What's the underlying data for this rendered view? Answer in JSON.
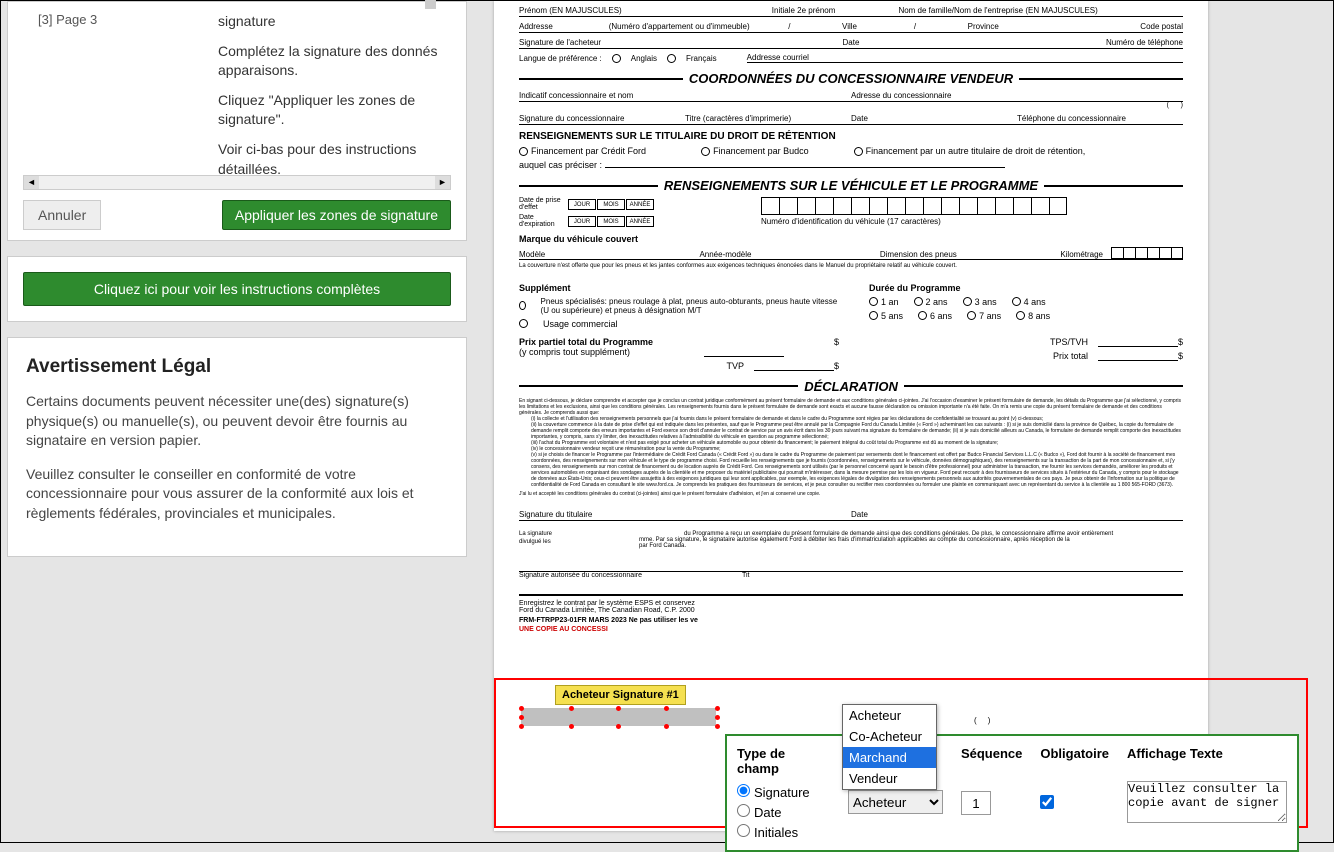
{
  "leftPanel": {
    "pageLabel": "[3] Page 3",
    "instr1": "signature",
    "instr2": "Complétez la signature des donnés apparaisons.",
    "instr3": "Cliquez \"Appliquer les zones de signature\".",
    "instr4": "Voir ci-bas pour des instructions détaillées.",
    "cancelBtn": "Annuler",
    "applyBtn": "Appliquer les zones de signature",
    "fullInstrBtn": "Cliquez ici pour voir les instructions complètes",
    "legalTitle": "Avertissement Légal",
    "legalP1": "Certains documents peuvent nécessiter une(des) signature(s) physique(s) ou manuelle(s), ou peuvent devoir être fournis au signataire en version papier.",
    "legalP2": "Veuillez consulter le conseiller en conformité de votre concessionnaire pour vous assurer de la conformité aux lois et règlements fédérales, provinciales et municipales."
  },
  "doc": {
    "prenom": "Prénom (EN MAJUSCULES)",
    "initiale": "Initiale 2e prénom",
    "nomFamille": "Nom de famille/Nom de l'entreprise (EN MAJUSCULES)",
    "addresse": "Addresse",
    "numApp": "(Numéro d'appartement ou d'immeuble)",
    "ville": "Ville",
    "province": "Province",
    "codePostal": "Code postal",
    "sigAcheteur": "Signature de l'acheteur",
    "date": "Date",
    "numTel": "Numéro de téléphone",
    "langPref": "Langue de préférence :",
    "anglais": "Anglais",
    "francais": "Français",
    "addrCourriel": "Addresse courriel",
    "coordTitle": "COORDONNÉES DU CONCESSIONNAIRE VENDEUR",
    "indicatif": "Indicatif concessionnaire et nom",
    "adrConc": "Adresse du concessionnaire",
    "sigConc": "Signature du concessionnaire",
    "titre": "Titre (caractères d'imprimerie)",
    "telConc": "Téléphone du concessionnaire",
    "rensTitulaire": "RENSEIGNEMENTS SUR LE TITULAIRE DU DROIT DE RÉTENTION",
    "finFord": "Financement par Crédit Ford",
    "finBudco": "Financement par Budco",
    "finAutre": "Financement par un autre titulaire de droit de rétention,",
    "auquel": "auquel cas préciser :",
    "rensVehicule": "RENSEIGNEMENTS SUR LE VÉHICULE ET LE PROGRAMME",
    "datePrise": "Date de prise d'effet",
    "dateExp": "Date d'expiration",
    "jour": "JOUR",
    "mois": "MOIS",
    "annee": "ANNÉE",
    "numIdent": "Numéro d'identification du véhicule (17 caractères)",
    "marque": "Marque du véhicule couvert",
    "modele": "Modèle",
    "anneeModele": "Année-modèle",
    "dimPneus": "Dimension des pneus",
    "kilometrage": "Kilométrage",
    "coverageNote": "La couverture n'est offerte que pour les pneus et les jantes conformes aux exigences techniques énoncées dans le Manuel du propriétaire relatif au véhicule couvert.",
    "supplement": "Supplément",
    "pneusSpec": "Pneus spécialisés: pneus roulage à plat, pneus auto-obturants, pneus haute vitesse (U ou supérieure) et pneus à désignation M/T",
    "usageComm": "Usage commercial",
    "dureeProgramme": "Durée du Programme",
    "an1": "1 an",
    "ans2": "2 ans",
    "ans3": "3 ans",
    "ans4": "4 ans",
    "ans5": "5 ans",
    "ans6": "6 ans",
    "ans7": "7 ans",
    "ans8": "8 ans",
    "prixPartiel": "Prix partiel total du Programme",
    "yCompris": "(y compris tout supplément)",
    "tvp": "TVP",
    "tps": "TPS/TVH",
    "prixTotal": "Prix total",
    "declaration": "DÉCLARATION",
    "decl1": "En signant ci-dessous, je déclare comprendre et accepter que je conclus un contrat juridique conformément au présent formulaire de demande et aux conditions générales ci-jointes. J'ai l'occasion d'examiner le présent formulaire de demande, les détails du Programme que j'ai sélectionné, y compris les limitations et les exclusions, ainsi que les conditions générales. Les renseignements fournis dans le présent formulaire de demande sont exacts et aucune fausse déclaration ou omission importante n'a été faite. On m'a remis une copie du présent formulaire de demande et des conditions générales. Je comprends aussi que:",
    "decla": "(i)   la collecte et l'utilisation des renseignements personnels que j'ai fournis dans le présent formulaire de demande et dans le cadre du Programme sont régies par les déclarations de confidentialité se trouvant au point (v) ci-dessous;",
    "declb": "(ii)  la couverture commence à la date de prise d'effet qui est indiquée dans les présentes, sauf que le Programme peut être annulé par la Compagnie Ford du Canada Limitée (« Ford ») acheminant les cas suivants : (i) si je suis domicilié dans la province de Québec, la copie du formulaire de demande remplit comporte des erreurs importantes et Ford exerce son droit d'annuler le contrat de service par un avis écrit dans les 30 jours suivant ma signature du formulaire de demande; (ii) si je suis domicilié ailleurs au Canada, le formulaire de demande remplit comporte des inexactitudes importantes, y compris, sans s'y limiter, des inexactitudes relatives à l'admissibilité du véhicule en question au programme sélectionné;",
    "declc": "(iii) l'achat du Programme est volontaire et n'est pas exigé pour acheter un véhicule automobile ou pour obtenir du financement; le paiement intégral du coût total du Programme est dû au moment de la signature;",
    "decld": "(iv)  le concessionnaire vendeur reçoit une rémunération pour la vente du Programme;",
    "decle": "(v)   si je choisis de financer le Programme par l'intermédiaire de Crédit Ford Canada (« Crédit Ford ») ou dans le cadre du Programme de paiement par versements dont le financement est offert par Budco Financial Services L.L.C (« Budco »), Ford doit fournir à la société de financement mes coordonnées, des renseignements sur mon véhicule et le type de programme choisi. Ford recueille les renseignements que je fournis (coordonnées, renseignements sur le véhicule, données démographiques), des renseignements sur la transaction de la part de mon concessionnaire et, si j'y consens, des renseignements sur mon contrat de financement ou de location auprès de Crédit Ford. Ces renseignements sont utilisés (par le personnel concerné ayant le besoin d'être professionnel) pour administrer la transaction, me fournir les services demandés, améliorer les produits et services automobiles en organisant des sondages auprès de la clientèle et me proposer du matériel publicitaire qui pourrait m'intéresser, dans la mesure permise par les lois en vigueur. Ford peut recourir à des fournisseurs de services situés à l'extérieur du Canada, y compris pour le stockage de données aux États-Unis; ceux-ci peuvent être assujettis à des exigences juridiques qui leur sont applicables, par exemple, les exigences légales de divulgation des renseignements personnels aux autorités gouvernementales de ces pays. Je peux obtenir de l'information sur la politique de confidentialité de Ford Canada en consultant le site www.ford.ca. Je comprends les pratiques des fournisseurs de services, et je peux consulter ou rectifier mes coordonnées ou formuler une plainte en communiquant avec un représentant du service à la clientèle au 1 800 565-FORD (3673).",
    "decl2": "J'ai lu et accepté les conditions générales du contrat (ci-jointes) ainsi que le présent formulaire d'adhésion, et j'en ai conservé une copie.",
    "sigTitulaire": "Signature du titulaire",
    "acheteurSig": "Acheteur Signature #1",
    "hiddenText1": "du Programme a reçu un exemplaire du présent formulaire de demande ainsi que des conditions générales. De plus, le concessionnaire affirme avoir entièrement",
    "hiddenText2": "mme. Par sa signature, le signataire autorise également Ford à débiter les frais d'immatriculation applicables au compte du concessionnaire, après réception de la",
    "hiddenText3": "par Ford Canada.",
    "sigAutorisee": "Signature autorisée du concessionnaire",
    "enregistrez": "Enregistrez le contrat par le système ESPS et conservez",
    "fordCanada": "Ford du Canada Limitée, The Canadian Road, C.P. 2000",
    "frmCode": "FRM-FTRPP23-01FR   MARS 2023   Ne pas utiliser les ve",
    "uneCopie": "UNE COPIE AU CONCESSI"
  },
  "popup": {
    "typeChamp": "Type de champ",
    "signature": "Signature",
    "dateOpt": "Date",
    "initiales": "Initiales",
    "sequence": "Séquence",
    "obligatoire": "Obligatoire",
    "affichageTexte": "Affichage Texte",
    "seqValue": "1",
    "textareaValue": "Veuillez consulter la copie avant de signer",
    "selectValue": "Acheteur",
    "dropdownOptions": [
      "Acheteur",
      "Co-Acheteur",
      "Marchand",
      "Vendeur"
    ]
  }
}
